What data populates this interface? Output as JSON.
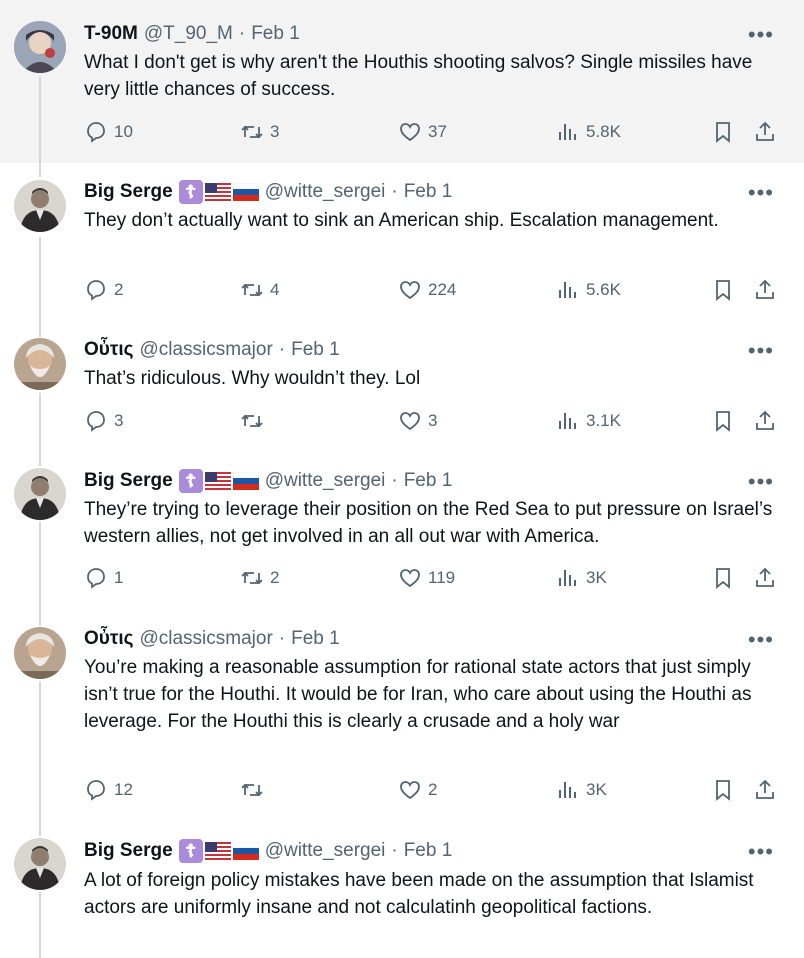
{
  "colors": {
    "text": "#0f1419",
    "muted": "#536471",
    "line": "#cfd9de",
    "highlight_bg": "#f3f3f3"
  },
  "icons": [
    "more-icon",
    "reply-icon",
    "retweet-icon",
    "like-icon",
    "views-icon",
    "bookmark-icon",
    "share-icon"
  ],
  "tweets": [
    {
      "name": "T-90M",
      "handle": "@T_90_M",
      "date": "Feb 1",
      "text": "What I don't get is why aren't the Houthis shooting salvos? Single missiles have very little chances of success.",
      "replies": "10",
      "retweets": "3",
      "likes": "37",
      "views": "5.8K"
    },
    {
      "name": "Big Serge",
      "handle": "@witte_sergei",
      "date": "Feb 1",
      "text": "They don’t actually want to sink an American ship. Escalation management.",
      "replies": "2",
      "retweets": "4",
      "likes": "224",
      "views": "5.6K"
    },
    {
      "name": "Οὖτις",
      "handle": "@classicsmajor",
      "date": "Feb 1",
      "text": "That’s ridiculous. Why wouldn’t they. Lol",
      "replies": "3",
      "retweets": "",
      "likes": "3",
      "views": "3.1K"
    },
    {
      "name": "Big Serge",
      "handle": "@witte_sergei",
      "date": "Feb 1",
      "text": "They’re trying to leverage their position on the Red Sea to put pressure on Israel’s western allies, not get involved in an all out war with America.",
      "replies": "1",
      "retweets": "2",
      "likes": "119",
      "views": "3K"
    },
    {
      "name": "Οὖτις",
      "handle": "@classicsmajor",
      "date": "Feb 1",
      "text": "You’re making a reasonable assumption for rational state actors that just simply isn’t true for the Houthi. It would be for Iran, who care about using the Houthi as leverage. For the Houthi this is clearly a crusade and a holy war",
      "replies": "12",
      "retweets": "",
      "likes": "2",
      "views": "3K"
    },
    {
      "name": "Big Serge",
      "handle": "@witte_sergei",
      "date": "Feb 1",
      "text": "A lot of foreign policy mistakes have been made on the assumption that Islamist actors are uniformly insane and not calculatinh geopolitical factions.",
      "replies": "",
      "retweets": "",
      "likes": "",
      "views": ""
    }
  ],
  "more_glyph": "•••",
  "badge_cross": "☦"
}
